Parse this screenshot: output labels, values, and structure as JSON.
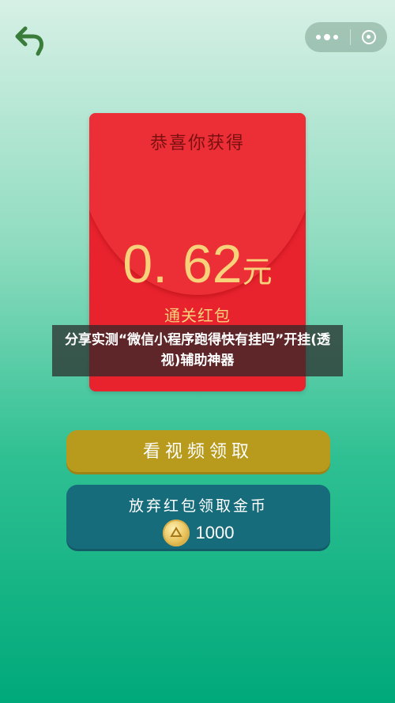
{
  "topbar": {
    "back_icon": "back-arrow-icon",
    "back_color": "#3a7d3a",
    "menu_icon": "more-dots-icon",
    "close_icon": "target-close-icon"
  },
  "envelope": {
    "title": "恭喜你获得",
    "amount": "0. 62",
    "unit": "元",
    "subtitle": "通关红包",
    "color": "#e8232e",
    "gold": "#f7d27a"
  },
  "overlay": {
    "text": "分享实测“微信小程序跑得快有挂吗”开挂(透视)辅助神器"
  },
  "buttons": {
    "video_label": "看视频领取",
    "video_color": "#b89a1c",
    "coins_label": "放弃红包领取金币",
    "coins_amount": "1000",
    "coins_color": "#176c7c",
    "coin_icon": "gold-coin-icon"
  }
}
